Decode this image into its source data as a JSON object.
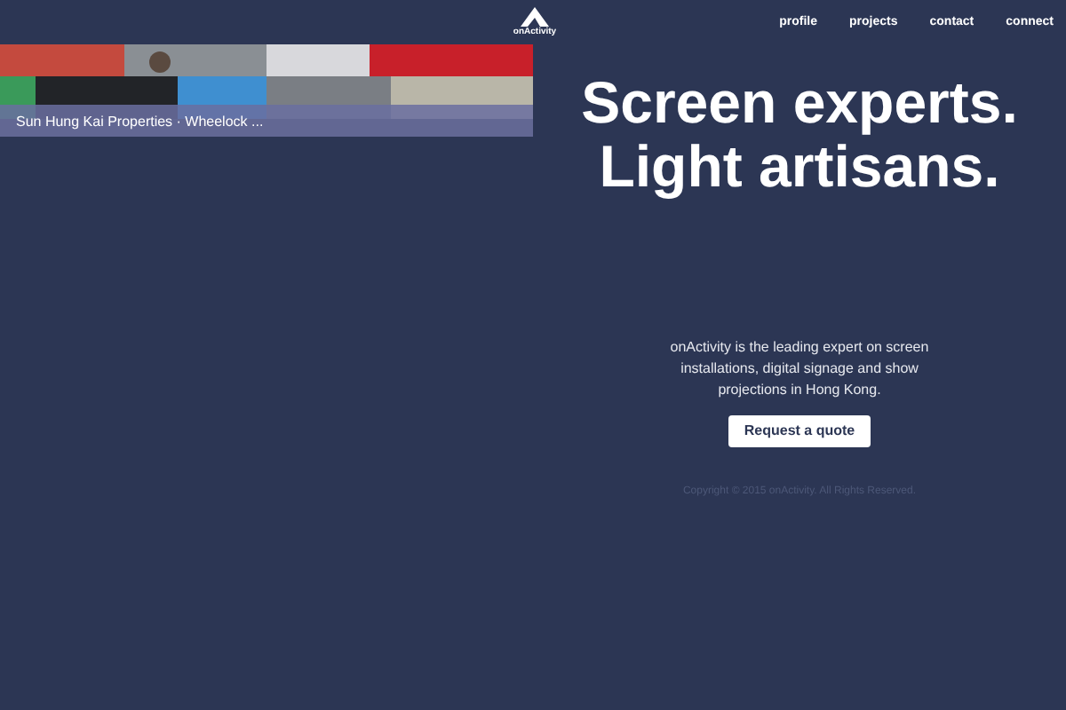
{
  "logo": {
    "text": "onActivity"
  },
  "nav": [
    {
      "label": "profile"
    },
    {
      "label": "projects"
    },
    {
      "label": "contact"
    },
    {
      "label": "connect"
    }
  ],
  "project_strip": {
    "kind": "picture",
    "caption": "Sun Hung Kai Properties · Wheelock ..."
  },
  "hero": {
    "headline_lines": [
      "Screen experts.",
      "Light artisans."
    ],
    "description": "onActivity is the leading expert on screen installations, digital signage and show projections in Hong Kong.",
    "button": "Request a quote"
  },
  "footer": {
    "copyright": "Copyright © 2015 onActivity. All Rights Reserved."
  }
}
